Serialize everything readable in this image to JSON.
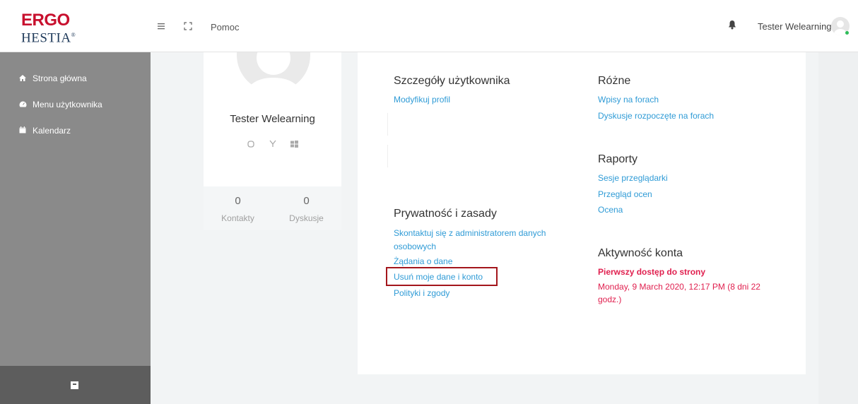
{
  "header": {
    "logo_line1": "ERGO",
    "logo_line2": "HESTIA",
    "logo_registered": "®",
    "help_label": "Pomoc",
    "user_name": "Tester Welearning"
  },
  "sidebar": {
    "items": [
      {
        "label": "Strona główna",
        "icon": "home-icon"
      },
      {
        "label": "Menu użytkownika",
        "icon": "dashboard-icon"
      },
      {
        "label": "Kalendarz",
        "icon": "calendar-icon"
      }
    ]
  },
  "profile": {
    "name": "Tester Welearning",
    "social_icons": [
      "skype-icon",
      "yahoo-icon",
      "windows-icon"
    ],
    "stats": [
      {
        "value": "0",
        "label": "Kontakty"
      },
      {
        "value": "0",
        "label": "Dyskusje"
      }
    ]
  },
  "sections": {
    "user_details": {
      "title": "Szczegóły użytkownika",
      "links": [
        "Modyfikuj profil"
      ]
    },
    "misc": {
      "title": "Różne",
      "links": [
        "Wpisy na forach",
        "Dyskusje rozpoczęte na forach"
      ]
    },
    "reports": {
      "title": "Raporty",
      "links": [
        "Sesje przeglądarki",
        "Przegląd ocen",
        "Ocena"
      ]
    },
    "privacy": {
      "title": "Prywatność i zasady",
      "links": [
        "Skontaktuj się z administratorem danych",
        "osobowych",
        "Żądania o dane",
        "Usuń moje dane i konto",
        "Polityki i zgody"
      ]
    },
    "activity": {
      "title": "Aktywność konta",
      "first_access_label": "Pierwszy dostęp do strony",
      "first_access_value": "Monday, 9 March 2020, 12:17 PM  (8 dni 22 godz.)"
    }
  },
  "colors": {
    "brand_red": "#c8102e",
    "link_blue": "#2f9bd6",
    "highlight_red": "#a3161c",
    "sidebar_bg": "#8a8a8a"
  }
}
